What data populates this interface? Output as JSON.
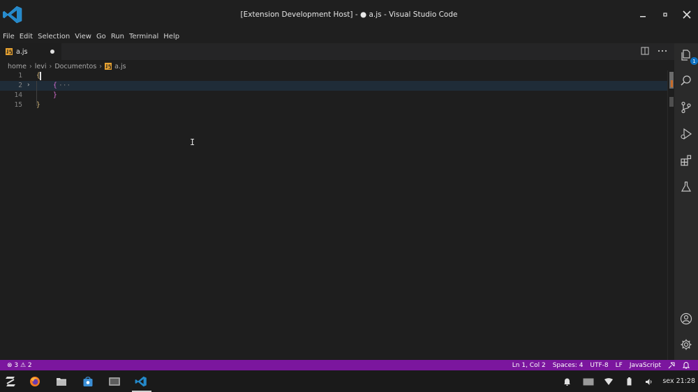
{
  "window": {
    "title": "[Extension Development Host] - ● a.js - Visual Studio Code"
  },
  "menu": [
    "File",
    "Edit",
    "Selection",
    "View",
    "Go",
    "Run",
    "Terminal",
    "Help"
  ],
  "tab": {
    "filename": "a.js",
    "dirty": true
  },
  "breadcrumb": {
    "parts": [
      "home",
      "levi",
      "Documentos"
    ],
    "file": "a.js"
  },
  "editor": {
    "lines": [
      {
        "num": "1",
        "code": "{"
      },
      {
        "num": "2",
        "code": "{",
        "folded": true,
        "ellipsis": "···"
      },
      {
        "num": "14",
        "code": "}"
      },
      {
        "num": "15",
        "code": "}"
      }
    ]
  },
  "activity": {
    "explorer_badge": "1"
  },
  "status": {
    "problems": "⊗ 3 ⚠ 2",
    "position": "Ln 1, Col 2",
    "spaces": "Spaces: 4",
    "encoding": "UTF-8",
    "eol": "LF",
    "language": "JavaScript"
  },
  "taskbar": {
    "clock": "sex 21:28"
  },
  "colors": {
    "statusbar": "#7b169e",
    "accent": "#0e70c0",
    "js_icon": "#e8a331"
  }
}
